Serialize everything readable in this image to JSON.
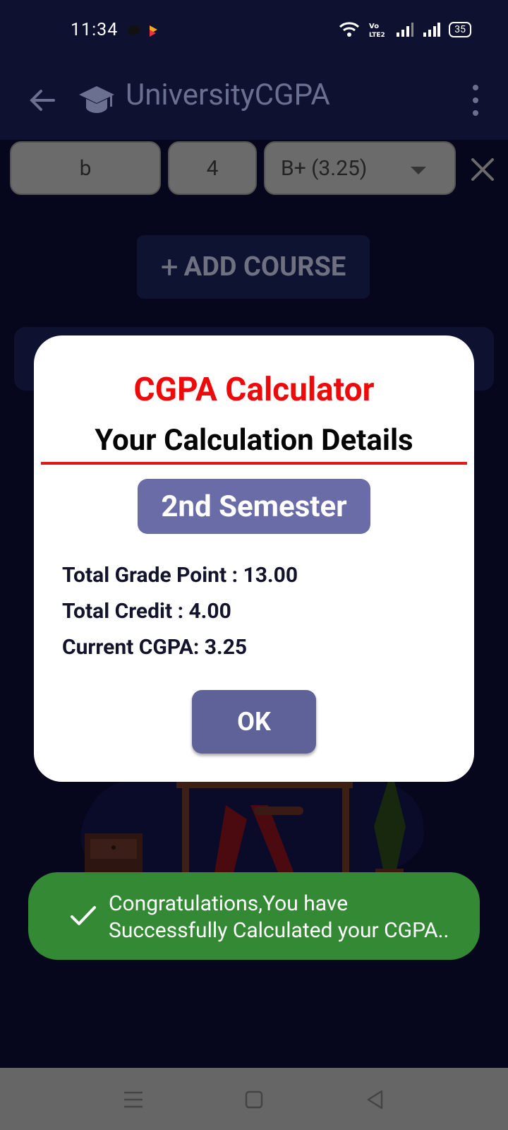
{
  "status": {
    "time": "11:34",
    "battery": "35"
  },
  "app_bar": {
    "title": "UniversityCGPA"
  },
  "course": {
    "name": "b",
    "credit": "4",
    "grade": "B+ (3.25)"
  },
  "add_course_label": "ADD COURSE",
  "add_course_icon": "+",
  "dialog": {
    "heading": "CGPA Calculator",
    "subheading": "Your Calculation Details",
    "semester": "2nd Semester",
    "total_grade_point": "Total Grade Point : 13.00",
    "total_credit": "Total Credit : 4.00",
    "current_cgpa": "Current CGPA: 3.25",
    "ok_label": "OK"
  },
  "toast": {
    "line1": "Congratulations,You have",
    "line2": "Successfully Calculated your CGPA.."
  },
  "colors": {
    "background": "#06071d",
    "app_bar": "#0e1230",
    "heading_red": "#ee0a0a",
    "badge_purple": "#6a6ca8",
    "ok_button": "#5f6299",
    "toast_green": "#348a34"
  },
  "icons": [
    "back-arrow-icon",
    "graduation-cap-icon",
    "more-vert-icon",
    "close-icon",
    "dropdown-caret-icon",
    "check-icon",
    "nav-menu-icon",
    "nav-home-icon",
    "nav-back-icon"
  ]
}
